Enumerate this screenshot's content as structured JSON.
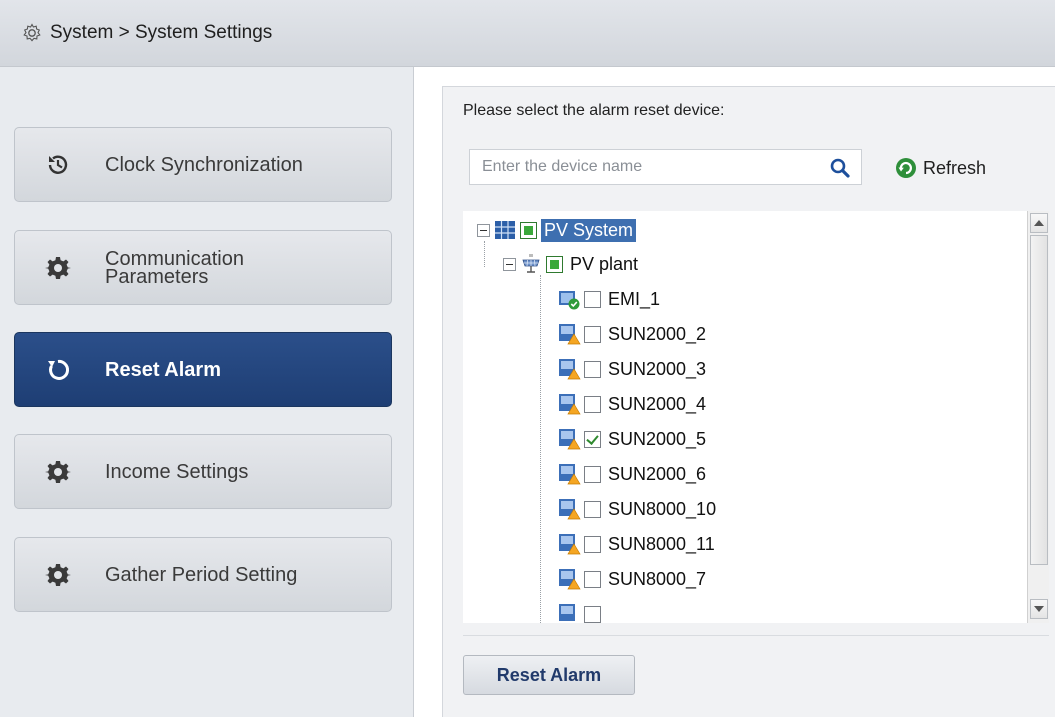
{
  "header": {
    "title": "System > System Settings",
    "icon": "gear-outline-icon"
  },
  "sidebar": {
    "items": [
      {
        "label": "Clock Synchronization",
        "icon": "clock-history-icon",
        "active": false
      },
      {
        "label": "Communication Parameters",
        "icon": "gear-icon",
        "active": false
      },
      {
        "label": "Reset Alarm",
        "icon": "reset-circle-icon",
        "active": true
      },
      {
        "label": "Income Settings",
        "icon": "gear-icon",
        "active": false
      },
      {
        "label": "Gather Period Setting",
        "icon": "gear-icon",
        "active": false
      }
    ]
  },
  "main": {
    "prompt": "Please select the alarm reset device:",
    "search": {
      "placeholder": "Enter the device name",
      "value": ""
    },
    "refresh_label": "Refresh",
    "tree": {
      "root": {
        "label": "PV System",
        "selected": true,
        "state": "all-checked"
      },
      "plant": {
        "label": "PV plant",
        "state": "all-checked"
      },
      "devices": [
        {
          "label": "EMI_1",
          "checked": false,
          "icon": "emi-device-icon"
        },
        {
          "label": "SUN2000_2",
          "checked": false,
          "icon": "inverter-warning-icon"
        },
        {
          "label": "SUN2000_3",
          "checked": false,
          "icon": "inverter-warning-icon"
        },
        {
          "label": "SUN2000_4",
          "checked": false,
          "icon": "inverter-warning-icon"
        },
        {
          "label": "SUN2000_5",
          "checked": true,
          "icon": "inverter-warning-icon"
        },
        {
          "label": "SUN2000_6",
          "checked": false,
          "icon": "inverter-warning-icon"
        },
        {
          "label": "SUN8000_10",
          "checked": false,
          "icon": "inverter-warning-icon"
        },
        {
          "label": "SUN8000_11",
          "checked": false,
          "icon": "inverter-warning-icon"
        },
        {
          "label": "SUN8000_7",
          "checked": false,
          "icon": "inverter-warning-icon"
        }
      ]
    },
    "reset_button_label": "Reset Alarm"
  },
  "colors": {
    "active_nav": "#1e3e74",
    "selection": "#3e6fb0",
    "accent_green": "#3aa83a",
    "warning": "#f5a623"
  }
}
